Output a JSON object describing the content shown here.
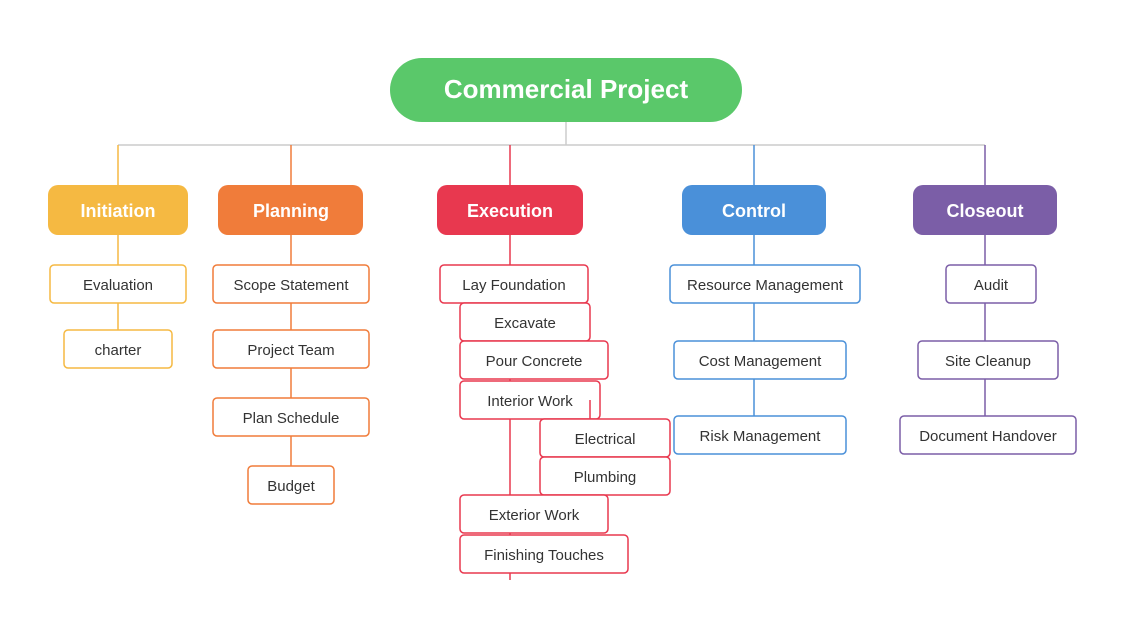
{
  "title": "Commercial Project",
  "colors": {
    "root": "#5ac86a",
    "initiation": "#f5b942",
    "planning": "#f07c3a",
    "execution": "#e8384f",
    "control": "#4a90d9",
    "closeout": "#7b5ea7",
    "line_initiation": "#f5b942",
    "line_planning": "#f07c3a",
    "line_execution": "#e8384f",
    "line_control": "#4a90d9",
    "line_closeout": "#7b5ea7",
    "node_bg": "#fff"
  },
  "branches": {
    "initiation": {
      "label": "Initiation",
      "children": [
        "Evaluation",
        "charter"
      ]
    },
    "planning": {
      "label": "Planning",
      "children": [
        "Scope Statement",
        "Project Team",
        "Plan Schedule",
        "Budget"
      ]
    },
    "execution": {
      "label": "Execution",
      "children": [
        "Lay Foundation",
        "Excavate",
        "Pour Concrete",
        "Interior Work",
        "Electrical",
        "Plumbing",
        "Exterior Work",
        "Finishing Touches"
      ]
    },
    "control": {
      "label": "Control",
      "children": [
        "Resource Management",
        "Cost Management",
        "Risk Management"
      ]
    },
    "closeout": {
      "label": "Closeout",
      "children": [
        "Audit",
        "Site Cleanup",
        "Document Handover"
      ]
    }
  }
}
